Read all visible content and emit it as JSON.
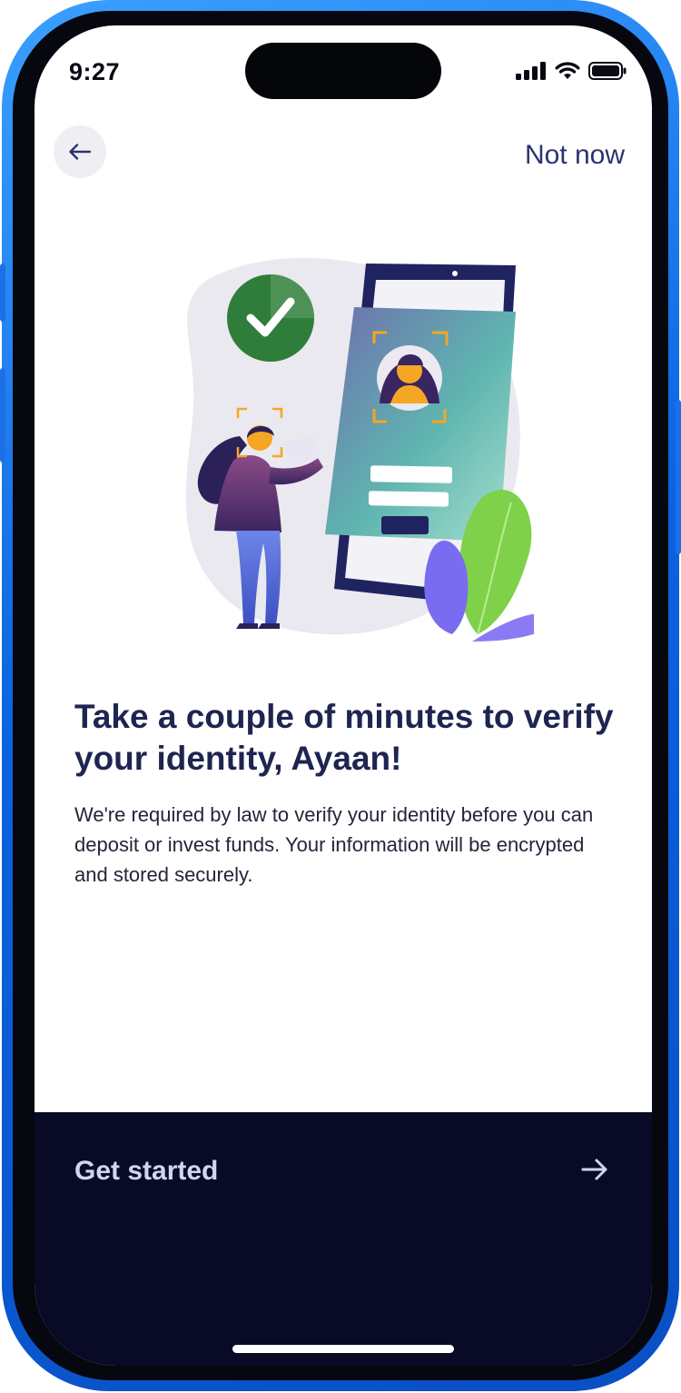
{
  "status_bar": {
    "time": "9:27"
  },
  "header": {
    "back_icon": "arrow-left-icon",
    "skip_label": "Not now"
  },
  "illustration": {
    "subject": "identity-verification-illustration"
  },
  "content": {
    "headline": "Take a couple of minutes to verify your identity, Ayaan!",
    "body": "We're required by law to verify your identity before you can deposit or invest funds. Your information will be encrypted and stored securely."
  },
  "cta": {
    "label": "Get started",
    "icon": "arrow-right-icon"
  },
  "colors": {
    "device_frame": "#0b63e0",
    "cta_background": "#080a26",
    "headline": "#1e2550",
    "link": "#2a3370",
    "check_green": "#2f7d3a",
    "leaf_green": "#7fd14a",
    "leaf_purple": "#7a6cf0",
    "frame_orange": "#f5a623"
  }
}
